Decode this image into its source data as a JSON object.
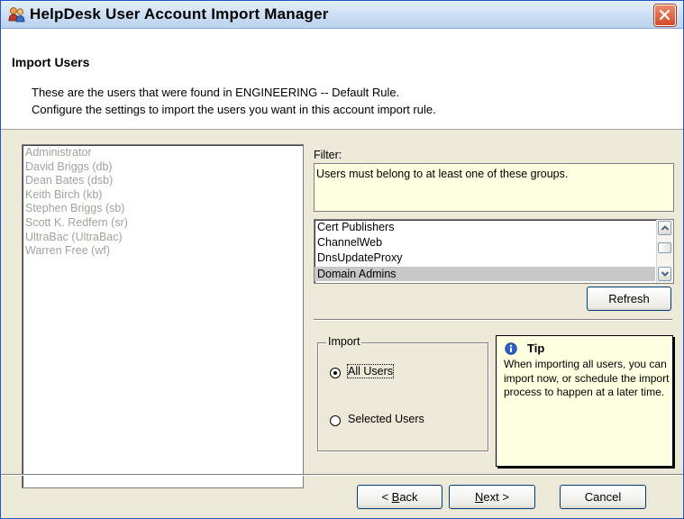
{
  "window": {
    "title": "HelpDesk User Account Import Manager",
    "icon": "users-app-icon",
    "close_icon": "close-icon"
  },
  "header": {
    "title": "Import Users",
    "line1": "These are the users that were found in ENGINEERING -- Default Rule.",
    "line2": "Configure the settings to import the users you want in this account import rule."
  },
  "users": [
    "Administrator",
    "David Briggs (db)",
    "Dean Bates (dsb)",
    "Keith Birch (kb)",
    "Stephen Briggs (sb)",
    "Scott K. Redfern (sr)",
    "UltraBac (UltraBac)",
    "Warren Free (wf)"
  ],
  "filter": {
    "label": "Filter:",
    "description": "Users must belong to at least one of these groups."
  },
  "groups": {
    "items": [
      "Cert Publishers",
      "ChannelWeb",
      "DnsUpdateProxy",
      "Domain Admins"
    ],
    "selected": "Domain Admins"
  },
  "refresh_label": "Refresh",
  "import": {
    "legend": "Import",
    "all_users": "All Users",
    "selected_users": "Selected Users",
    "selected_option": "All Users"
  },
  "tip": {
    "title": "Tip",
    "body": "When importing all users, you can import now, or schedule the import process to happen at a later time."
  },
  "buttons": {
    "back_prefix": "< ",
    "back_accel": "B",
    "back_rest": "ack",
    "next_accel": "N",
    "next_rest": "ext >",
    "cancel": "Cancel"
  },
  "colors": {
    "disabled_text": "#a2a29a",
    "tooltip_bg": "#ffffe1",
    "selection": "#c7c7c7",
    "dialog_bg": "#ece9d8"
  }
}
